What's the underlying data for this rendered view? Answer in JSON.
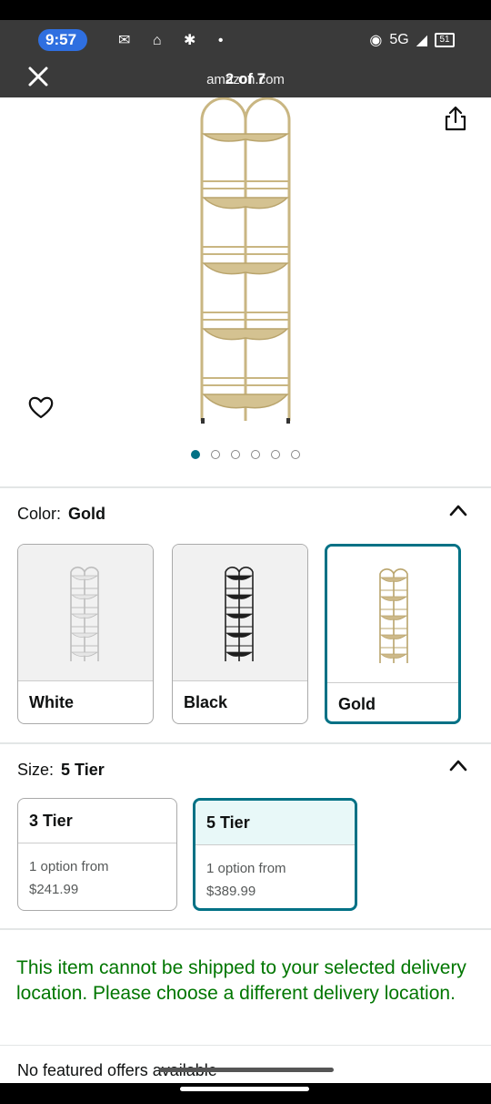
{
  "status_bar": {
    "time": "9:57",
    "network": "5G",
    "battery": "51"
  },
  "browser": {
    "url": "amazon.com",
    "image_counter": "2 of 7"
  },
  "gallery": {
    "dot_count": 6,
    "active_index": 0
  },
  "color_section": {
    "label": "Color:",
    "selected": "Gold",
    "options": [
      {
        "name": "White",
        "color": "#e6e6e6"
      },
      {
        "name": "Black",
        "color": "#1e1e1e"
      },
      {
        "name": "Gold",
        "color": "#cdb98a"
      }
    ]
  },
  "size_section": {
    "label": "Size:",
    "selected": "5 Tier",
    "options": [
      {
        "name": "3 Tier",
        "line1": "1 option from",
        "price": "$241.99"
      },
      {
        "name": "5 Tier",
        "line1": "1 option from",
        "price": "$389.99"
      }
    ]
  },
  "shipping_warning": "This item cannot be shipped to your selected delivery location. Please choose a different delivery location.",
  "offers_text": "No featured offers available",
  "colors": {
    "accent": "#007185",
    "warning_green": "#007600",
    "product_gold": "#cdb98a"
  }
}
